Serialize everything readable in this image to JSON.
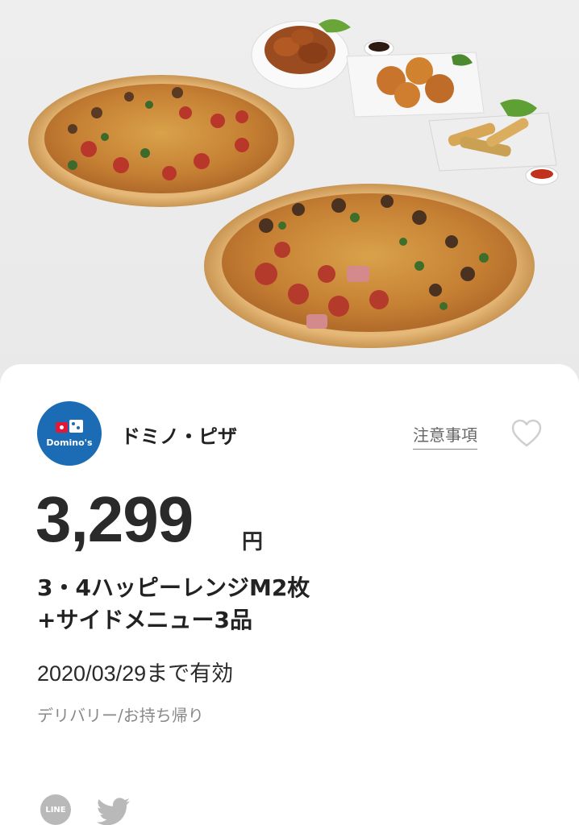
{
  "shop": {
    "name": "ドミノ・ピザ",
    "logo_text": "Domino's"
  },
  "header": {
    "notes_label": "注意事項",
    "favorite_icon": "heart-outline-icon"
  },
  "offer": {
    "price": "3,299",
    "currency": "円",
    "title_line1": "3・4ハッピーレンジM2枚",
    "title_line2": "+サイドメニュー3品",
    "valid_until": "2020/03/29まで有効",
    "delivery": "デリバリー/お持ち帰り"
  },
  "share": {
    "line_label": "LINE",
    "twitter_icon": "twitter-icon"
  },
  "colors": {
    "brand_blue": "#1b6cb5",
    "brand_red": "#e31837",
    "icon_gray": "#b9b9b9"
  }
}
